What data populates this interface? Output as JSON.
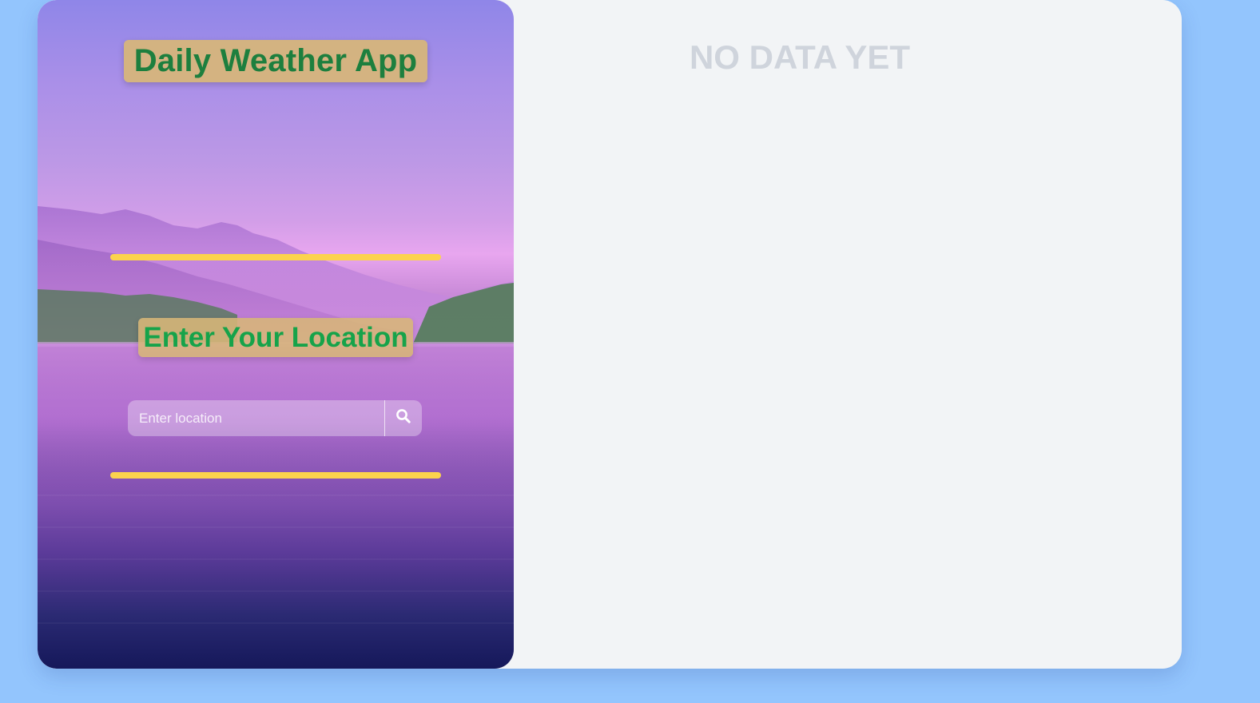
{
  "app": {
    "title": "Daily Weather App",
    "location_heading": "Enter Your Location"
  },
  "search": {
    "placeholder": "Enter location",
    "value": "",
    "button_icon": "search-icon"
  },
  "results": {
    "empty_message": "NO DATA YET"
  },
  "colors": {
    "page_background": "#93c5fd",
    "card_background": "#f2f4f6",
    "title_text": "#1d7f3e",
    "heading_text": "#16a34a",
    "badge_background": "#d7b678",
    "divider": "#fcd34d",
    "empty_text": "#cfd4dc"
  }
}
